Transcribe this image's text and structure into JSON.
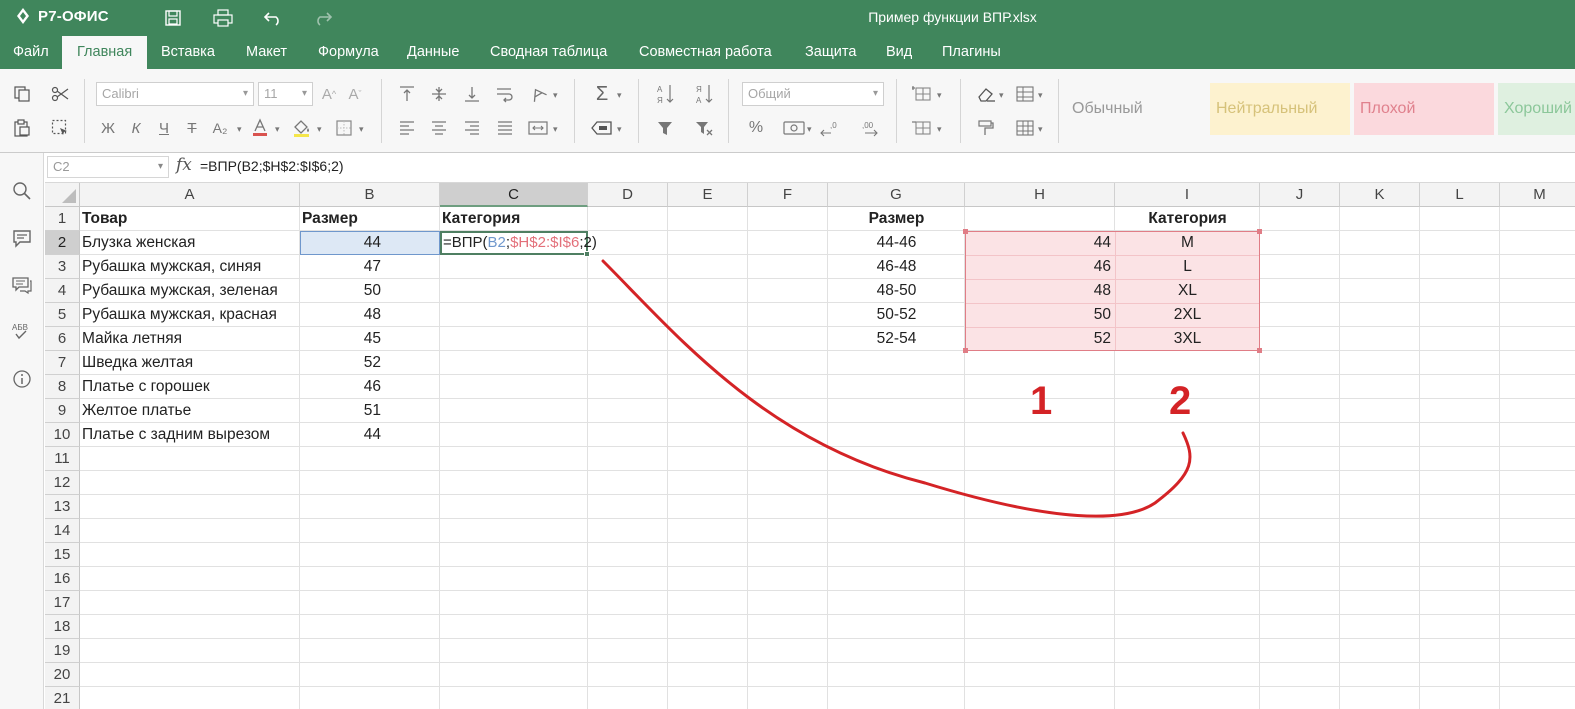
{
  "app": {
    "logo_text": "Р7-ОФИС",
    "doc_title": "Пример функции ВПР.xlsx"
  },
  "menu": {
    "tabs": [
      "Файл",
      "Главная",
      "Вставка",
      "Макет",
      "Формула",
      "Данные",
      "Сводная таблица",
      "Совместная работа",
      "Защита",
      "Вид",
      "Плагины"
    ],
    "active": "Главная"
  },
  "toolbar": {
    "font_name": "Calibri",
    "font_size": "11",
    "number_format": "Общий",
    "format_buttons": {
      "bold": "Ж",
      "italic": "К",
      "underline": "Ч",
      "strike": "Т",
      "subscript": "A₂"
    },
    "percent": "%",
    "cell_styles": [
      {
        "label": "Обычный",
        "bg": "#f7f7f7",
        "color": "#999999"
      },
      {
        "label": "Нейтральный",
        "bg": "#fdf2cf",
        "color": "#d6c27a"
      },
      {
        "label": "Плохой",
        "bg": "#fbd9dd",
        "color": "#e0818d"
      },
      {
        "label": "Хороший",
        "bg": "#dff0e0",
        "color": "#8cc79a"
      }
    ]
  },
  "formula_bar": {
    "cell_ref": "C2",
    "fx": "fx",
    "formula": "=ВПР(B2;$H$2:$I$6;2)"
  },
  "sheet": {
    "columns": [
      "A",
      "B",
      "C",
      "D",
      "E",
      "F",
      "G",
      "H",
      "I",
      "J",
      "K",
      "L",
      "M"
    ],
    "rows": [
      "1",
      "2",
      "3",
      "4",
      "5",
      "6",
      "7",
      "8",
      "9",
      "10",
      "11",
      "12",
      "13",
      "14",
      "15",
      "16",
      "17",
      "18",
      "19",
      "20",
      "21"
    ],
    "active_cell": "C2",
    "headers": {
      "A": "Товар",
      "B": "Размер",
      "C": "Категория",
      "G": "Размер",
      "I": "Категория"
    },
    "products": [
      {
        "name": "Блузка женская",
        "size": "44"
      },
      {
        "name": "Рубашка мужская, синяя",
        "size": "47"
      },
      {
        "name": "Рубашка мужская, зеленая",
        "size": "50"
      },
      {
        "name": "Рубашка мужская, красная",
        "size": "48"
      },
      {
        "name": "Майка летняя",
        "size": "45"
      },
      {
        "name": "Шведка желтая",
        "size": "52"
      },
      {
        "name": "Платье с горошек",
        "size": "46"
      },
      {
        "name": "Желтое платье",
        "size": "51"
      },
      {
        "name": "Платье с задним вырезом",
        "size": "44"
      }
    ],
    "edit_formula": {
      "prefix": "=ВПР(",
      "arg1": "B2",
      "sep1": ";",
      "arg2": "$H$2:$I$6",
      "suffix": ";2)",
      "arg1_color": "#6f97cc",
      "arg2_color": "#e3707a"
    },
    "lookup": [
      {
        "range": "44-46",
        "size": "44",
        "category": "M"
      },
      {
        "range": "46-48",
        "size": "46",
        "category": "L"
      },
      {
        "range": "48-50",
        "size": "48",
        "category": "XL"
      },
      {
        "range": "50-52",
        "size": "50",
        "category": "2XL"
      },
      {
        "range": "52-54",
        "size": "52",
        "category": "3XL"
      }
    ],
    "annotations": [
      "1",
      "2"
    ],
    "colors": {
      "brand_green": "#40865c",
      "lookup_fill": "#fbe3e5",
      "lookup_border": "#e07d86",
      "annotation_red": "#d42326",
      "selection_fill": "#dde8f5"
    }
  }
}
